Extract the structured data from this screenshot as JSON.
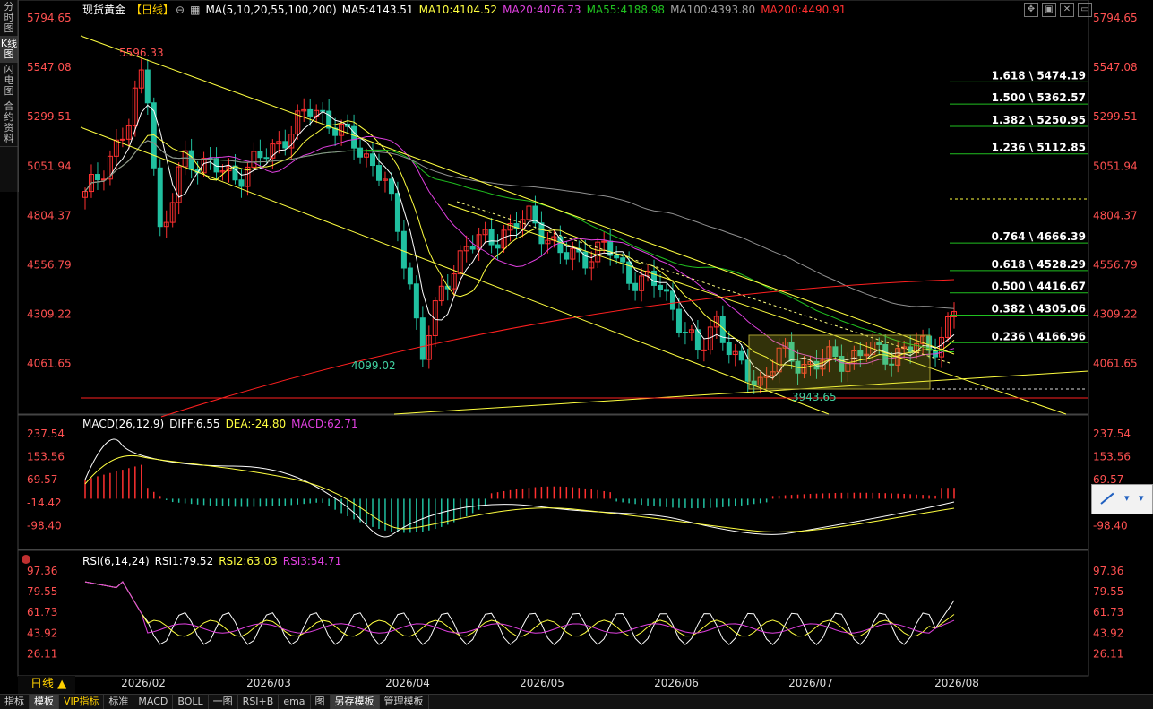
{
  "sidebar": {
    "items": [
      {
        "label": "分时图",
        "active": false
      },
      {
        "label": "K线图",
        "active": true
      },
      {
        "label": "闪电图",
        "active": false
      },
      {
        "label": "合约资料",
        "active": false
      }
    ]
  },
  "header": {
    "instrument": "现货黄金",
    "period": "【日线】",
    "ma_label": "MA(5,10,20,55,100,200)",
    "ma5": "MA5:4143.51",
    "ma10": "MA10:4104.52",
    "ma20": "MA20:4076.73",
    "ma55": "MA55:4188.98",
    "ma100": "MA100:4393.80",
    "ma200": "MA200:4490.91"
  },
  "colors": {
    "up": "#ff3030",
    "down": "#20c0a0",
    "ma5": "#ffffff",
    "ma10": "#ffff40",
    "ma20": "#e040e0",
    "ma55": "#20c020",
    "ma100": "#909090",
    "ma200": "#ff2020",
    "trend": "#ffff40",
    "fib": "#20c020"
  },
  "main_axis": {
    "ticks": [
      "5794.65",
      "5547.08",
      "5299.51",
      "5051.94",
      "4804.37",
      "4556.79",
      "4309.22",
      "4061.65"
    ]
  },
  "annotations": {
    "high": "5596.33",
    "low1": "4099.02",
    "low2": "3943.65"
  },
  "fib_levels": [
    {
      "label": "1.618 \\ 5474.19",
      "value": 5474.19
    },
    {
      "label": "1.500 \\ 5362.57",
      "value": 5362.57
    },
    {
      "label": "1.382 \\ 5250.95",
      "value": 5250.95
    },
    {
      "label": "1.236 \\ 5112.85",
      "value": 5112.85
    },
    {
      "label": "0.764 \\ 4666.39",
      "value": 4666.39
    },
    {
      "label": "0.618 \\ 4528.29",
      "value": 4528.29
    },
    {
      "label": "0.500 \\ 4416.67",
      "value": 4416.67
    },
    {
      "label": "0.382 \\ 4305.06",
      "value": 4305.06
    },
    {
      "label": "0.236 \\ 4166.96",
      "value": 4166.96
    }
  ],
  "macd": {
    "title": "MACD(26,12,9)",
    "diff": "DIFF:6.55",
    "dea": "DEA:-24.80",
    "macd": "MACD:62.71",
    "ticks": [
      "237.54",
      "153.56",
      "69.57",
      "-14.42",
      "-98.40"
    ]
  },
  "rsi": {
    "title": "RSI(6,14,24)",
    "rsi1": "RSI1:79.52",
    "rsi2": "RSI2:63.03",
    "rsi3": "RSI3:54.71",
    "ticks": [
      "97.36",
      "79.55",
      "61.73",
      "43.92",
      "26.11"
    ]
  },
  "dates": [
    "2026/02",
    "2026/03",
    "2026/04",
    "2026/05",
    "2026/06",
    "2026/07",
    "2026/08"
  ],
  "period_bar": {
    "label": "日线 ▲"
  },
  "bottom_tabs": [
    {
      "label": "指标",
      "sel": false,
      "vip": false
    },
    {
      "label": "模板",
      "sel": true,
      "vip": false
    },
    {
      "label": "VIP指标",
      "sel": false,
      "vip": true
    },
    {
      "label": "标准",
      "sel": false,
      "vip": false
    },
    {
      "label": "MACD",
      "sel": false,
      "vip": false
    },
    {
      "label": "BOLL",
      "sel": false,
      "vip": false
    },
    {
      "label": "一图",
      "sel": false,
      "vip": false
    },
    {
      "label": "RSI+B",
      "sel": false,
      "vip": false
    },
    {
      "label": "ema",
      "sel": false,
      "vip": false
    },
    {
      "label": "图",
      "sel": false,
      "vip": false
    },
    {
      "label": "另存模板",
      "sel": true,
      "vip": false
    },
    {
      "label": "管理模板",
      "sel": false,
      "vip": false
    }
  ]
}
